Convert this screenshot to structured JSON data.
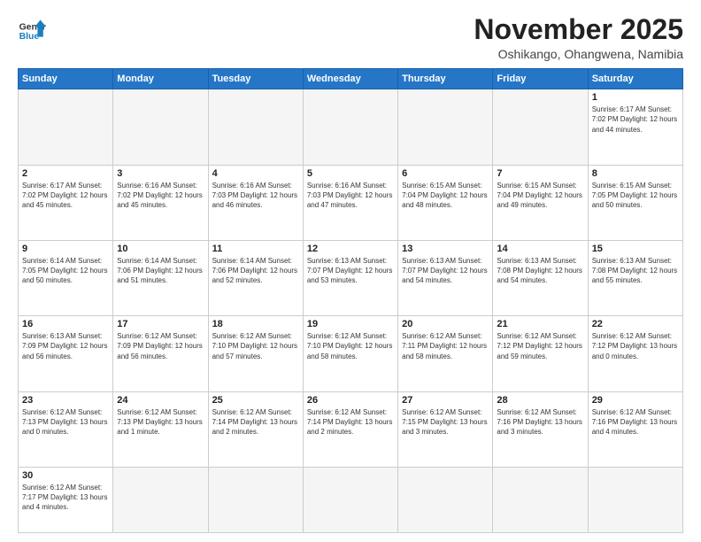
{
  "header": {
    "logo_general": "General",
    "logo_blue": "Blue",
    "month_title": "November 2025",
    "subtitle": "Oshikango, Ohangwena, Namibia"
  },
  "days_of_week": [
    "Sunday",
    "Monday",
    "Tuesday",
    "Wednesday",
    "Thursday",
    "Friday",
    "Saturday"
  ],
  "weeks": [
    [
      {
        "day": "",
        "info": ""
      },
      {
        "day": "",
        "info": ""
      },
      {
        "day": "",
        "info": ""
      },
      {
        "day": "",
        "info": ""
      },
      {
        "day": "",
        "info": ""
      },
      {
        "day": "",
        "info": ""
      },
      {
        "day": "1",
        "info": "Sunrise: 6:17 AM\nSunset: 7:02 PM\nDaylight: 12 hours\nand 44 minutes."
      }
    ],
    [
      {
        "day": "2",
        "info": "Sunrise: 6:17 AM\nSunset: 7:02 PM\nDaylight: 12 hours\nand 45 minutes."
      },
      {
        "day": "3",
        "info": "Sunrise: 6:16 AM\nSunset: 7:02 PM\nDaylight: 12 hours\nand 45 minutes."
      },
      {
        "day": "4",
        "info": "Sunrise: 6:16 AM\nSunset: 7:03 PM\nDaylight: 12 hours\nand 46 minutes."
      },
      {
        "day": "5",
        "info": "Sunrise: 6:16 AM\nSunset: 7:03 PM\nDaylight: 12 hours\nand 47 minutes."
      },
      {
        "day": "6",
        "info": "Sunrise: 6:15 AM\nSunset: 7:04 PM\nDaylight: 12 hours\nand 48 minutes."
      },
      {
        "day": "7",
        "info": "Sunrise: 6:15 AM\nSunset: 7:04 PM\nDaylight: 12 hours\nand 49 minutes."
      },
      {
        "day": "8",
        "info": "Sunrise: 6:15 AM\nSunset: 7:05 PM\nDaylight: 12 hours\nand 50 minutes."
      }
    ],
    [
      {
        "day": "9",
        "info": "Sunrise: 6:14 AM\nSunset: 7:05 PM\nDaylight: 12 hours\nand 50 minutes."
      },
      {
        "day": "10",
        "info": "Sunrise: 6:14 AM\nSunset: 7:06 PM\nDaylight: 12 hours\nand 51 minutes."
      },
      {
        "day": "11",
        "info": "Sunrise: 6:14 AM\nSunset: 7:06 PM\nDaylight: 12 hours\nand 52 minutes."
      },
      {
        "day": "12",
        "info": "Sunrise: 6:13 AM\nSunset: 7:07 PM\nDaylight: 12 hours\nand 53 minutes."
      },
      {
        "day": "13",
        "info": "Sunrise: 6:13 AM\nSunset: 7:07 PM\nDaylight: 12 hours\nand 54 minutes."
      },
      {
        "day": "14",
        "info": "Sunrise: 6:13 AM\nSunset: 7:08 PM\nDaylight: 12 hours\nand 54 minutes."
      },
      {
        "day": "15",
        "info": "Sunrise: 6:13 AM\nSunset: 7:08 PM\nDaylight: 12 hours\nand 55 minutes."
      }
    ],
    [
      {
        "day": "16",
        "info": "Sunrise: 6:13 AM\nSunset: 7:09 PM\nDaylight: 12 hours\nand 56 minutes."
      },
      {
        "day": "17",
        "info": "Sunrise: 6:12 AM\nSunset: 7:09 PM\nDaylight: 12 hours\nand 56 minutes."
      },
      {
        "day": "18",
        "info": "Sunrise: 6:12 AM\nSunset: 7:10 PM\nDaylight: 12 hours\nand 57 minutes."
      },
      {
        "day": "19",
        "info": "Sunrise: 6:12 AM\nSunset: 7:10 PM\nDaylight: 12 hours\nand 58 minutes."
      },
      {
        "day": "20",
        "info": "Sunrise: 6:12 AM\nSunset: 7:11 PM\nDaylight: 12 hours\nand 58 minutes."
      },
      {
        "day": "21",
        "info": "Sunrise: 6:12 AM\nSunset: 7:12 PM\nDaylight: 12 hours\nand 59 minutes."
      },
      {
        "day": "22",
        "info": "Sunrise: 6:12 AM\nSunset: 7:12 PM\nDaylight: 13 hours\nand 0 minutes."
      }
    ],
    [
      {
        "day": "23",
        "info": "Sunrise: 6:12 AM\nSunset: 7:13 PM\nDaylight: 13 hours\nand 0 minutes."
      },
      {
        "day": "24",
        "info": "Sunrise: 6:12 AM\nSunset: 7:13 PM\nDaylight: 13 hours\nand 1 minute."
      },
      {
        "day": "25",
        "info": "Sunrise: 6:12 AM\nSunset: 7:14 PM\nDaylight: 13 hours\nand 2 minutes."
      },
      {
        "day": "26",
        "info": "Sunrise: 6:12 AM\nSunset: 7:14 PM\nDaylight: 13 hours\nand 2 minutes."
      },
      {
        "day": "27",
        "info": "Sunrise: 6:12 AM\nSunset: 7:15 PM\nDaylight: 13 hours\nand 3 minutes."
      },
      {
        "day": "28",
        "info": "Sunrise: 6:12 AM\nSunset: 7:16 PM\nDaylight: 13 hours\nand 3 minutes."
      },
      {
        "day": "29",
        "info": "Sunrise: 6:12 AM\nSunset: 7:16 PM\nDaylight: 13 hours\nand 4 minutes."
      }
    ],
    [
      {
        "day": "30",
        "info": "Sunrise: 6:12 AM\nSunset: 7:17 PM\nDaylight: 13 hours\nand 4 minutes."
      },
      {
        "day": "",
        "info": ""
      },
      {
        "day": "",
        "info": ""
      },
      {
        "day": "",
        "info": ""
      },
      {
        "day": "",
        "info": ""
      },
      {
        "day": "",
        "info": ""
      },
      {
        "day": "",
        "info": ""
      }
    ]
  ]
}
